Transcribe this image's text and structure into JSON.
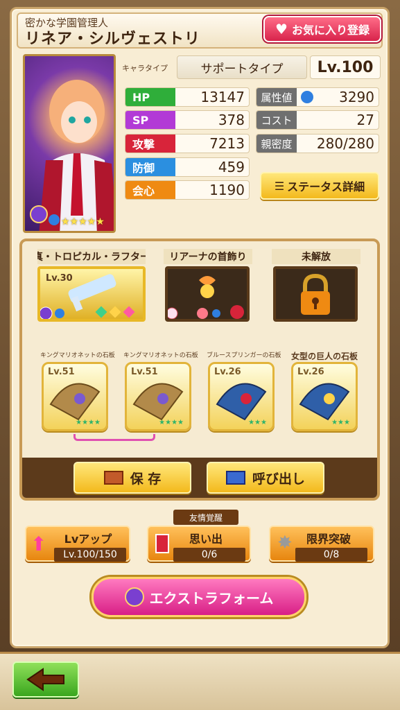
{
  "header": {
    "subtitle": "密かな学園管理人",
    "name": "リネア・シルヴェストリ",
    "favorite_label": "お気に入り登録"
  },
  "character": {
    "type_label": "キャラタイプ",
    "type_value": "サポートタイプ",
    "level": "Lv.100",
    "rarity_stars": "★★★★★"
  },
  "stats_left": [
    {
      "label": "HP",
      "value": "13147",
      "color": "#2fae3a"
    },
    {
      "label": "SP",
      "value": "378",
      "color": "#b23ad6"
    },
    {
      "label": "攻撃",
      "value": "7213",
      "color": "#d8243a"
    },
    {
      "label": "防御",
      "value": "459",
      "color": "#2b8fe0"
    },
    {
      "label": "会心",
      "value": "1190",
      "color": "#ef8a12"
    }
  ],
  "stats_right": [
    {
      "label": "属性値",
      "value": "3290"
    },
    {
      "label": "コスト",
      "value": "27"
    },
    {
      "label": "親密度",
      "value": "280/280"
    }
  ],
  "status_detail_label": "ステータス詳細",
  "equipment": [
    {
      "title": "真・トロピカル・ラフター",
      "level": "Lv.30"
    },
    {
      "title": "リアーナの首飾り"
    },
    {
      "title": "未解放"
    }
  ],
  "stones": [
    {
      "title": "キングマリオネットの石板",
      "level": "Lv.51",
      "stars": "★★★★"
    },
    {
      "title": "キングマリオネットの石板",
      "level": "Lv.51",
      "stars": "★★★★"
    },
    {
      "title": "ブルースプリンガーの石板",
      "level": "Lv.26",
      "stars": "★★★"
    },
    {
      "title": "女型の巨人の石板",
      "level": "Lv.26",
      "stars": "★★★"
    }
  ],
  "save_label": "保 存",
  "recall_label": "呼び出し",
  "friendship_tag": "友情覚醒",
  "levelup": {
    "label": "Lvアップ",
    "value": "Lv.100/150"
  },
  "memories": {
    "label": "思い出",
    "value": "0/6"
  },
  "limitbreak": {
    "label": "限界突破",
    "value": "0/8"
  },
  "extraform_label": "エクストラフォーム"
}
